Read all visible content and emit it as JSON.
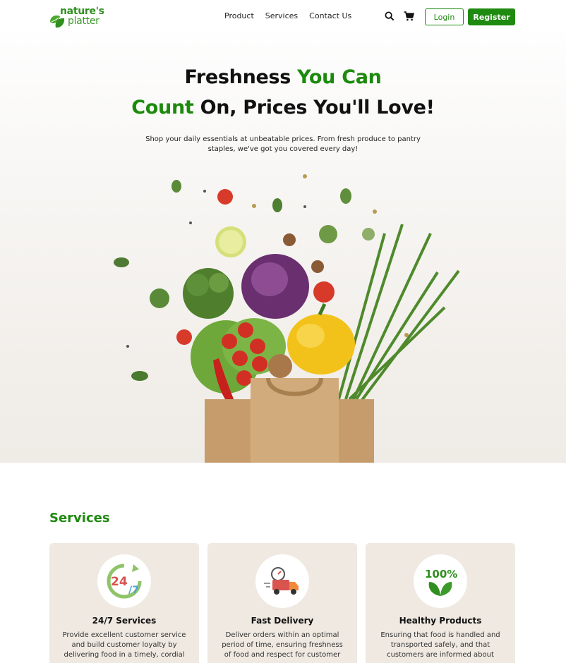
{
  "brand": {
    "line1": "nature's",
    "line2": "platter"
  },
  "nav": {
    "items": [
      "Product",
      "Services",
      "Contact Us"
    ]
  },
  "header": {
    "search_icon": "search-icon",
    "cart_icon": "cart-icon",
    "login_label": "Login",
    "register_label": "Register"
  },
  "hero": {
    "title_line1_dark": "Freshness ",
    "title_line1_green": "You Can",
    "title_line2_green": "Count",
    "title_line2_dark": " On, Prices You'll Love!",
    "subtitle_line1": "Shop your daily essentials at unbeatable prices. From fresh produce to pantry",
    "subtitle_line2": "staples, we've got you covered every day!"
  },
  "services": {
    "heading": "Services",
    "cards": [
      {
        "icon": "24-7-icon",
        "title": "24/7 Services",
        "desc": "Provide excellent customer service and build customer loyalty by delivering food in a timely, cordial"
      },
      {
        "icon": "delivery-truck-icon",
        "title": "Fast Delivery",
        "desc": "Deliver orders within an optimal period of time, ensuring freshness of food and respect for customer"
      },
      {
        "icon": "100-percent-organic-icon",
        "title": "Healthy Products",
        "desc": "Ensuring that food is handled and transported safely, and that customers are informed about"
      }
    ]
  },
  "colors": {
    "accent": "#1f8a10",
    "card_bg": "#efe9e1"
  }
}
